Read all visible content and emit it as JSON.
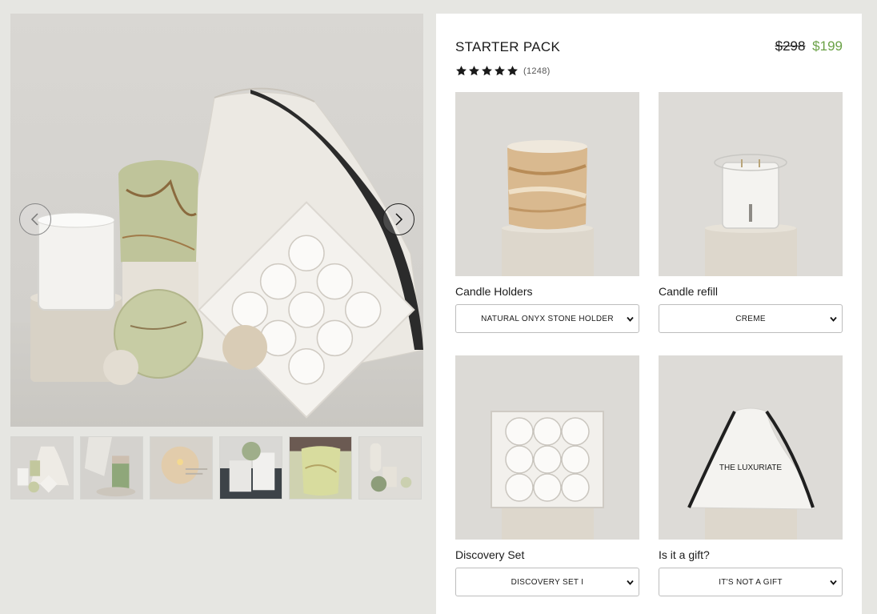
{
  "product": {
    "title": "STARTER PACK",
    "price_old": "$298",
    "price_new": "$199",
    "rating_stars": 5,
    "rating_count": "(1248)",
    "colors": {
      "accent_price": "#6aa146",
      "text": "#1a1a1a",
      "page_bg": "#e6e6e2"
    }
  },
  "gallery": {
    "prev_icon": "chevron-left-icon",
    "next_icon": "chevron-right-icon",
    "thumbnails": [
      "thumb-1",
      "thumb-2",
      "thumb-3",
      "thumb-4",
      "thumb-5",
      "thumb-6"
    ]
  },
  "options": [
    {
      "label": "Candle Holders",
      "selected": "NATURAL ONYX STONE HOLDER"
    },
    {
      "label": "Candle refill",
      "selected": "CREME"
    },
    {
      "label": "Discovery Set",
      "selected": "DISCOVERY SET I"
    },
    {
      "label": "Is it a gift?",
      "selected": "IT'S NOT A GIFT"
    }
  ],
  "bag_text": "THE LUXURIATE"
}
